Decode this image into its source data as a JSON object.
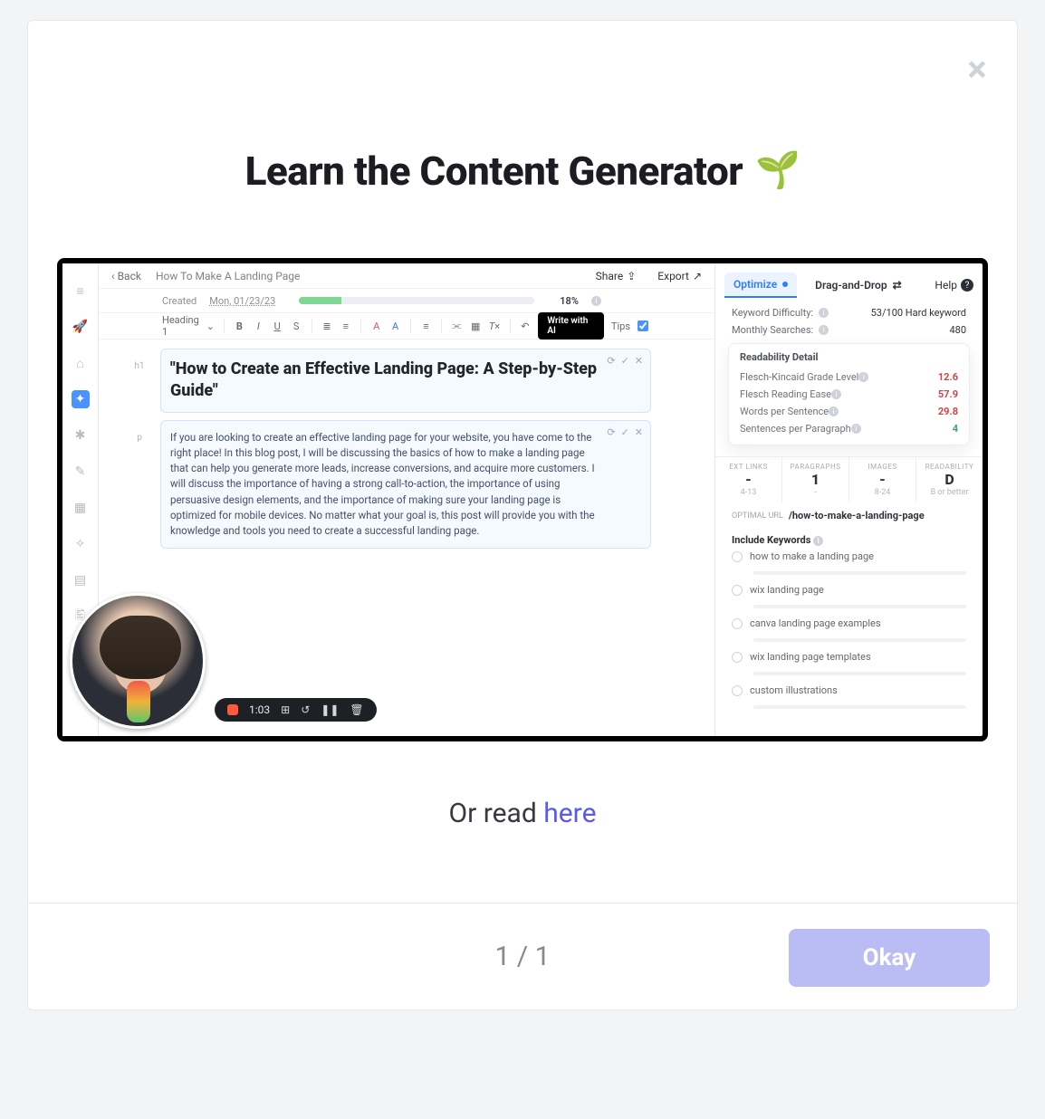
{
  "modal": {
    "title": "Learn the Content Generator",
    "emoji": "🌱",
    "close_label": "×",
    "or_read_prefix": "Or read ",
    "or_read_link": "here",
    "pager": "1 / 1",
    "okay": "Okay"
  },
  "app": {
    "back": "‹ Back",
    "doc_title": "How To Make A Landing Page",
    "share": "Share",
    "export": "Export",
    "created_label": "Created",
    "created_date": "Mon, 01/23/23",
    "progress_pct": "18%",
    "toolbar": {
      "heading": "Heading 1",
      "write_ai": "Write with AI",
      "tips": "Tips"
    },
    "blocks": {
      "h1_tag": "h1",
      "h1": "\"How to Create an Effective Landing Page: A Step-by-Step Guide\"",
      "p_tag": "p",
      "p": "If you are looking to create an effective landing page for your website, you have come to the right place! In this blog post, I will be discussing the basics of how to make a landing page that can help you generate more leads, increase conversions, and acquire more customers. I will discuss the importance of having a strong call-to-action, the importance of using persuasive design elements, and the importance of making sure your landing page is optimized for mobile devices. No matter what your goal is, this post will provide you with the knowledge and tools you need to create a successful landing page."
    },
    "rec_time": "1:03"
  },
  "panel": {
    "tabs": {
      "optimize": "Optimize",
      "dnd": "Drag-and-Drop",
      "help": "Help"
    },
    "kd_label": "Keyword Difficulty:",
    "kd_value": "53/100 Hard keyword",
    "ms_label": "Monthly Searches:",
    "ms_value": "480",
    "readability_detail": "Readability Detail",
    "metrics": [
      {
        "label": "Flesch-Kincaid Grade Level",
        "value": "12.6",
        "cls": "red"
      },
      {
        "label": "Flesch Reading Ease",
        "value": "57.9",
        "cls": "red"
      },
      {
        "label": "Words per Sentence",
        "value": "29.8",
        "cls": "red"
      },
      {
        "label": "Sentences per Paragraph",
        "value": "4",
        "cls": "green"
      }
    ],
    "stats": {
      "ext_links": {
        "lab": "EXT LINKS",
        "big": "-",
        "sub": "4-13"
      },
      "paragraphs": {
        "lab": "PARAGRAPHS",
        "big": "1",
        "sub": "-"
      },
      "images": {
        "lab": "IMAGES",
        "big": "-",
        "sub": "8-24"
      },
      "readability": {
        "lab": "READABILITY",
        "big": "D",
        "sub": "B or better"
      }
    },
    "optimal_url_label": "OPTIMAL URL",
    "optimal_url": "/how-to-make-a-landing-page",
    "include_kw_label": "Include Keywords",
    "keywords": [
      "how to make a landing page",
      "wix landing page",
      "canva landing page examples",
      "wix landing page templates",
      "custom illustrations"
    ]
  }
}
